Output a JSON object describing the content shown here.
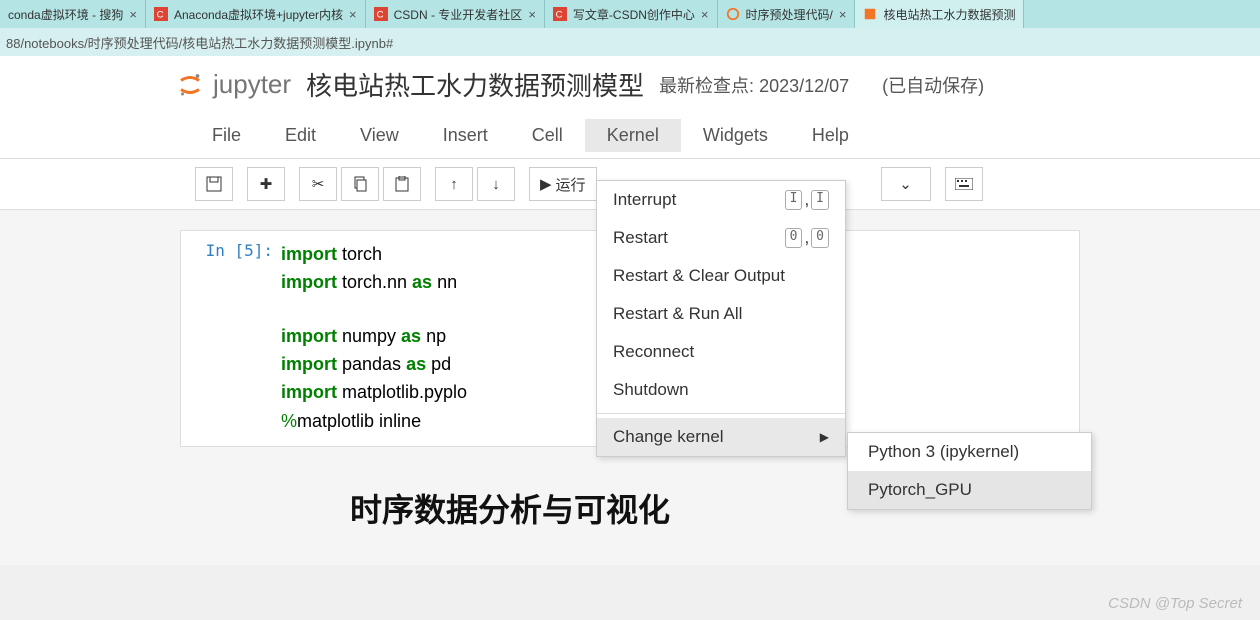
{
  "tabs": [
    {
      "title": "conda虚拟环境 - 搜狗",
      "icon": "sogou"
    },
    {
      "title": "Anaconda虚拟环境+jupyter内核",
      "icon": "csdn"
    },
    {
      "title": "CSDN - 专业开发者社区",
      "icon": "csdn"
    },
    {
      "title": "写文章-CSDN创作中心",
      "icon": "csdn"
    },
    {
      "title": "时序预处理代码/",
      "icon": "jupyter"
    },
    {
      "title": "核电站热工水力数据预测",
      "icon": "jupyter-nb"
    }
  ],
  "address": "88/notebooks/时序预处理代码/核电站热工水力数据预测模型.ipynb#",
  "logo_text": "jupyter",
  "notebook_title": "核电站热工水力数据预测模型",
  "checkpoint": "最新检查点: 2023/12/07",
  "autosave": "(已自动保存)",
  "menus": [
    "File",
    "Edit",
    "View",
    "Insert",
    "Cell",
    "Kernel",
    "Widgets",
    "Help"
  ],
  "open_menu": "Kernel",
  "toolbar": {
    "run_label": "运行"
  },
  "kernel_menu": {
    "interrupt": "Interrupt",
    "interrupt_keys": [
      "I",
      "I"
    ],
    "restart": "Restart",
    "restart_keys": [
      "0",
      "0"
    ],
    "restart_clear": "Restart & Clear Output",
    "restart_run": "Restart & Run All",
    "reconnect": "Reconnect",
    "shutdown": "Shutdown",
    "change_kernel": "Change kernel"
  },
  "kernel_sub": {
    "py3": "Python 3 (ipykernel)",
    "pytorch": "Pytorch_GPU"
  },
  "cell": {
    "prompt": "In  [5]:",
    "lines": {
      "l1_kw": "import",
      "l1_rest": " torch",
      "l2_kw": "import",
      "l2_mid": " torch.nn ",
      "l2_as": "as",
      "l2_end": " nn",
      "l3_kw": "import",
      "l3_mid": " numpy ",
      "l3_as": "as",
      "l3_end": " np",
      "l4_kw": "import",
      "l4_mid": " pandas ",
      "l4_as": "as",
      "l4_end": " pd",
      "l5_kw": "import",
      "l5_rest": " matplotlib.pyplo",
      "l6_kw": "%",
      "l6_rest": "matplotlib inline"
    }
  },
  "md_heading": "时序数据分析与可视化",
  "watermark": "CSDN @Top Secret"
}
